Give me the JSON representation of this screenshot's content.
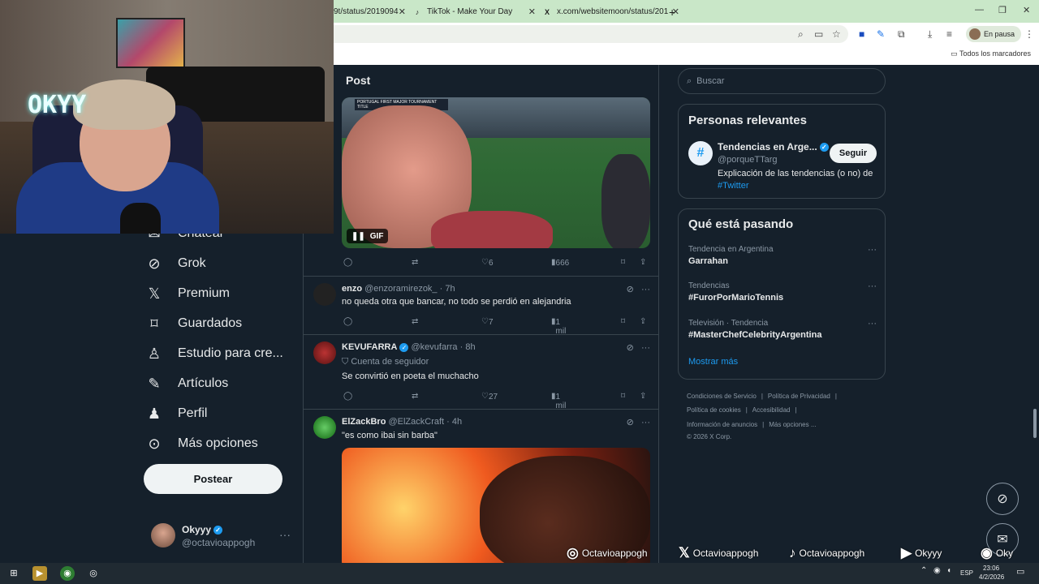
{
  "browser": {
    "tabs": [
      {
        "label": "9t/status/2019094",
        "favicon": "x-logo"
      },
      {
        "label": "TikTok - Make Your Day",
        "favicon": "tiktok-logo"
      },
      {
        "label": "x.com/websitemoon/status/201",
        "favicon": "x-logo"
      }
    ],
    "new_tab": "+",
    "profile_status": "En pausa",
    "bookmarks_all": "Todos los marcadores"
  },
  "webcam": {
    "neon_text": "OKYY"
  },
  "nav": {
    "items": [
      {
        "label": "Chatear",
        "icon": "chat-icon"
      },
      {
        "label": "Grok",
        "icon": "grok-icon"
      },
      {
        "label": "Premium",
        "icon": "x-icon"
      },
      {
        "label": "Guardados",
        "icon": "bookmark-icon"
      },
      {
        "label": "Estudio para cre...",
        "icon": "flask-icon"
      },
      {
        "label": "Artículos",
        "icon": "article-icon"
      },
      {
        "label": "Perfil",
        "icon": "person-icon"
      },
      {
        "label": "Más opciones",
        "icon": "more-icon"
      }
    ],
    "post_button": "Postear",
    "account": {
      "name": "Okyyy",
      "handle": "@octavioappogh",
      "more": "···"
    }
  },
  "center": {
    "title": "Post",
    "gif": {
      "label": "GIF",
      "header": "PORTUGAL FIRST MAJOR TOURNAMENT TITLE"
    },
    "main_actions": {
      "likes": "6",
      "views": "666"
    },
    "replies": [
      {
        "name": "enzo",
        "handle": "@enzoramirezok_",
        "time": "· 7h",
        "text": "no queda otra que bancar, no todo se perdió en alejandria",
        "likes": "7",
        "views": "1 mil",
        "verified": false,
        "follow_note": ""
      },
      {
        "name": "KEVUFARRA",
        "handle": "@kevufarra",
        "time": "· 8h",
        "text": "Se convirtió en poeta el muchacho",
        "likes": "27",
        "views": "1 mil",
        "verified": true,
        "follow_note": "Cuenta de seguidor"
      },
      {
        "name": "ElZackBro",
        "handle": "@ElZackCraft",
        "time": "· 4h",
        "text": "\"es como ibai sin barba\"",
        "likes": "",
        "views": "",
        "verified": false,
        "follow_note": ""
      }
    ]
  },
  "right": {
    "search_placeholder": "Buscar",
    "relevant": {
      "title": "Personas relevantes",
      "name": "Tendencias en Arge...",
      "handle": "@porqueTTarg",
      "bio": "Explicación de las tendencias (o no) de",
      "bio_link": "#Twitter",
      "follow": "Seguir"
    },
    "happening": {
      "title": "Qué está pasando",
      "trends": [
        {
          "context": "Tendencia en Argentina",
          "title": "Garrahan"
        },
        {
          "context": "Tendencias",
          "title": "#FurorPorMarioTennis"
        },
        {
          "context": "Televisión · Tendencia",
          "title": "#MasterChefCelebrityArgentina"
        }
      ],
      "more": "Mostrar más"
    },
    "footer": {
      "line1": [
        "Condiciones de Servicio",
        "Política de Privacidad"
      ],
      "line2": [
        "Política de cookies",
        "Accesibilidad"
      ],
      "line3": [
        "Información de anuncios",
        "Más opciones ..."
      ],
      "copyright": "© 2026 X Corp."
    }
  },
  "overlay": {
    "instagram": "Octavioappogh",
    "x": "Octavioappogh",
    "tiktok": "Octavioappogh",
    "youtube": "Okyyy",
    "spotify": "Oky"
  },
  "taskbar": {
    "lang": "ESP",
    "time": "23:06",
    "date": "4/2/2026"
  },
  "colors": {
    "accent": "#1d9bf0",
    "bg": "#15202b",
    "border": "#38444d",
    "muted": "#8b98a5"
  }
}
